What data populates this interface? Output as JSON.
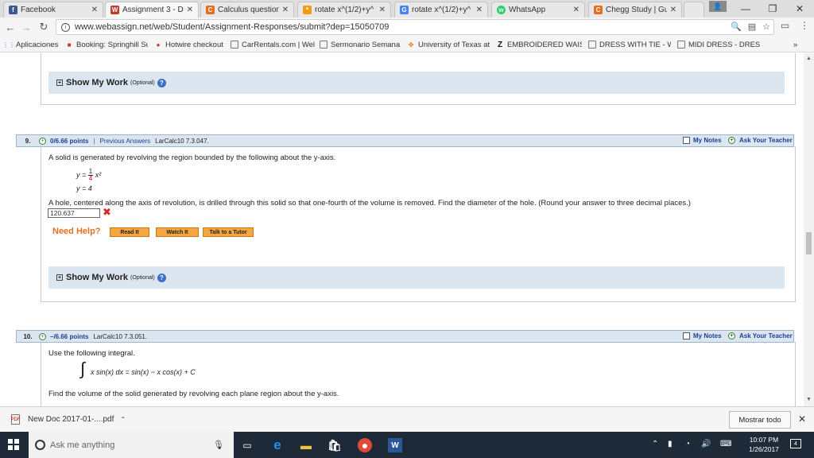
{
  "browser": {
    "tabs": [
      {
        "label": "Facebook",
        "icon": "facebook-icon",
        "color": "#3b5998",
        "glyph": "f"
      },
      {
        "label": "Assignment 3 - Du",
        "icon": "webassign-icon",
        "color": "#c0392b",
        "glyph": "W"
      },
      {
        "label": "Calculus question",
        "icon": "chegg-icon",
        "color": "#e86c1f",
        "glyph": "C"
      },
      {
        "label": "rotate x^(1/2)+y^",
        "icon": "wolfram-icon",
        "color": "#f39c12",
        "glyph": "*"
      },
      {
        "label": "rotate x^(1/2)+y^",
        "icon": "google-icon",
        "color": "#4285f4",
        "glyph": "G"
      },
      {
        "label": "WhatsApp",
        "icon": "whatsapp-icon",
        "color": "#25d366",
        "glyph": "w"
      },
      {
        "label": "Chegg Study | Gui",
        "icon": "chegg-icon",
        "color": "#e86c1f",
        "glyph": "C"
      }
    ],
    "url": "www.webassign.net/web/Student/Assignment-Responses/submit?dep=15050709",
    "bookmarks": [
      {
        "label": "Aplicaciones",
        "icon": "apps-grid-icon"
      },
      {
        "label": "Booking: Springhill Su",
        "icon": "booking-icon"
      },
      {
        "label": "Hotwire checkout",
        "icon": "hotwire-icon"
      },
      {
        "label": "CarRentals.com | Wel",
        "icon": "page-icon"
      },
      {
        "label": "Sermonario Semana",
        "icon": "page-icon"
      },
      {
        "label": "University of Texas at",
        "icon": "utexas-icon"
      },
      {
        "label": "EMBROIDERED WAIST",
        "icon": "z-icon"
      },
      {
        "label": "DRESS WITH TIE - WA",
        "icon": "page-icon"
      },
      {
        "label": "MIDI DRESS - DRESSE",
        "icon": "page-icon"
      }
    ],
    "more_bookmarks": "»"
  },
  "page": {
    "show_work_label": "Show My Work",
    "optional_label": "(Optional)",
    "q9": {
      "number": "9.",
      "points": "0/6.66 points",
      "sep": "|",
      "previous_answers": "Previous Answers",
      "reference": "LarCalc10 7.3.047.",
      "my_notes": "My Notes",
      "ask_teacher": "Ask Your Teacher",
      "text1": "A solid is generated by revolving the region bounded by the following about the y-axis.",
      "eq1_lhs": "y =",
      "eq1_num": "1",
      "eq1_den": "4",
      "eq1_tail": "x²",
      "eq2": "y = 4",
      "text2": "A hole, centered along the axis of revolution, is drilled through this solid so that one-fourth of the volume is removed. Find the diameter of the hole. (Round your answer to three decimal places.)",
      "answer": "120.637",
      "need_help": "Need Help?",
      "read_it": "Read It",
      "watch_it": "Watch It",
      "talk_tutor": "Talk to a Tutor"
    },
    "q10": {
      "number": "10.",
      "points": "–/6.66 points",
      "reference": "LarCalc10 7.3.051.",
      "my_notes": "My Notes",
      "ask_teacher": "Ask Your Teacher",
      "text1": "Use the following integral.",
      "integral_expr": "x sin(x) dx = sin(x) − x cos(x) + C",
      "text2": "Find the volume of the solid generated by revolving each plane region about the y-axis."
    }
  },
  "downloads": {
    "file": "New Doc 2017-01-....pdf",
    "show_all": "Mostrar todo"
  },
  "taskbar": {
    "search_placeholder": "Ask me anything",
    "time": "10:07 PM",
    "date": "1/26/2017"
  },
  "colors": {
    "accent_blue": "#1c3f94",
    "header_bg": "#dce6f1",
    "need_help": "#e07020",
    "wrong": "#d22222"
  }
}
